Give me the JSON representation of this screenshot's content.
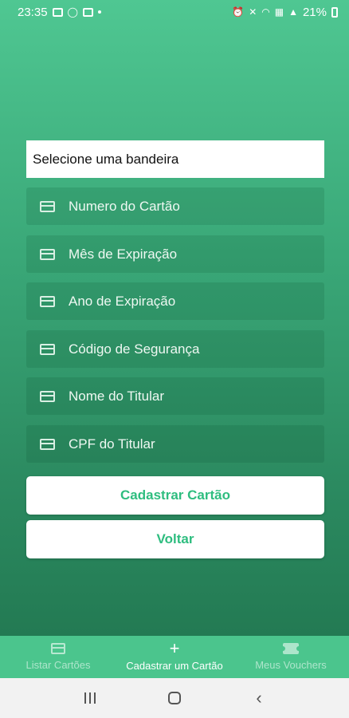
{
  "status_bar": {
    "time": "23:35",
    "battery": "21%",
    "left_icons": [
      "gallery-icon",
      "whatsapp-icon",
      "youtube-icon",
      "dot-icon"
    ],
    "right_icons": [
      "alarm-icon",
      "mute-icon",
      "wifi-icon",
      "volte-icon",
      "signal-icon",
      "battery-icon"
    ]
  },
  "form": {
    "select_placeholder": "Selecione uma bandeira",
    "fields": [
      {
        "label": "Numero do Cartão",
        "icon": "credit-card-icon"
      },
      {
        "label": "Mês de Expiração",
        "icon": "credit-card-icon"
      },
      {
        "label": "Ano de Expiração",
        "icon": "credit-card-icon"
      },
      {
        "label": "Código de Segurança",
        "icon": "credit-card-icon"
      },
      {
        "label": "Nome do Titular",
        "icon": "credit-card-icon"
      },
      {
        "label": "CPF do Titular",
        "icon": "credit-card-icon"
      }
    ],
    "submit_label": "Cadastrar Cartão",
    "back_label": "Voltar"
  },
  "bottom_nav": {
    "items": [
      {
        "label": "Listar Cartões",
        "icon": "credit-card-icon",
        "active": false
      },
      {
        "label": "Cadastrar um Cartão",
        "icon": "plus-icon",
        "active": true
      },
      {
        "label": "Meus Vouchers",
        "icon": "ticket-icon",
        "active": false
      }
    ]
  },
  "colors": {
    "accent": "#2ebd7f",
    "nav_bg": "#4bc58d",
    "gradient_top": "#4fc792",
    "gradient_bottom": "#237a53"
  }
}
